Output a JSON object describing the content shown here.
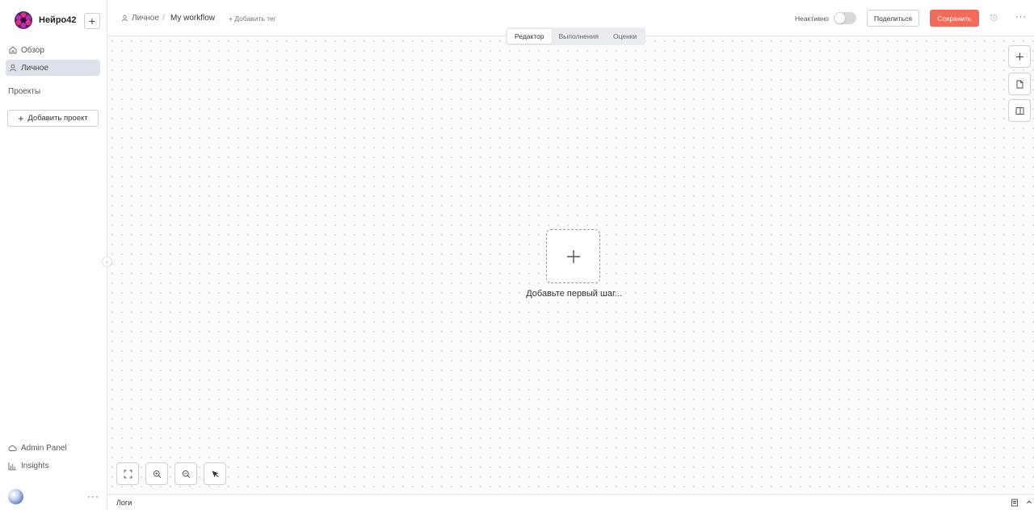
{
  "brand": {
    "name": "Нейро42"
  },
  "sidebar": {
    "new_button": "+",
    "nav": [
      {
        "label": "Обзор",
        "icon": "home-icon",
        "active": false
      },
      {
        "label": "Личное",
        "icon": "user-icon",
        "active": true
      }
    ],
    "section_title": "Проекты",
    "add_project": {
      "plus": "+",
      "label": "Добавить проект"
    },
    "bottom": [
      {
        "label": "Admin Panel",
        "icon": "cloud-icon"
      },
      {
        "label": "Insights",
        "icon": "bar-chart-icon"
      }
    ],
    "more": "···",
    "collapse": "‹"
  },
  "header": {
    "breadcrumb": {
      "workspace": "Личное",
      "separator": "/",
      "current": "My workflow"
    },
    "add_tag": "+ Добавить тег",
    "status_label": "Неактивно",
    "toggle_on": false,
    "share_label": "Поделиться",
    "save_label": "Сохранить",
    "more": "···"
  },
  "tabs": [
    {
      "label": "Редактор",
      "active": true
    },
    {
      "label": "Выполнения",
      "active": false
    },
    {
      "label": "Оценки",
      "active": false
    }
  ],
  "canvas": {
    "first_step_label": "Добавьте первый шаг..."
  },
  "right_tools": [
    "plus-icon",
    "note-icon",
    "panel-icon"
  ],
  "bottom_tools": [
    "fit-view-icon",
    "zoom-in-icon",
    "zoom-out-icon",
    "cursor-icon"
  ],
  "logs": {
    "label": "Логи"
  },
  "colors": {
    "accent": "#f36b5b",
    "active_nav": "#dde2ea",
    "tabs_bg": "#e9ecf1"
  }
}
